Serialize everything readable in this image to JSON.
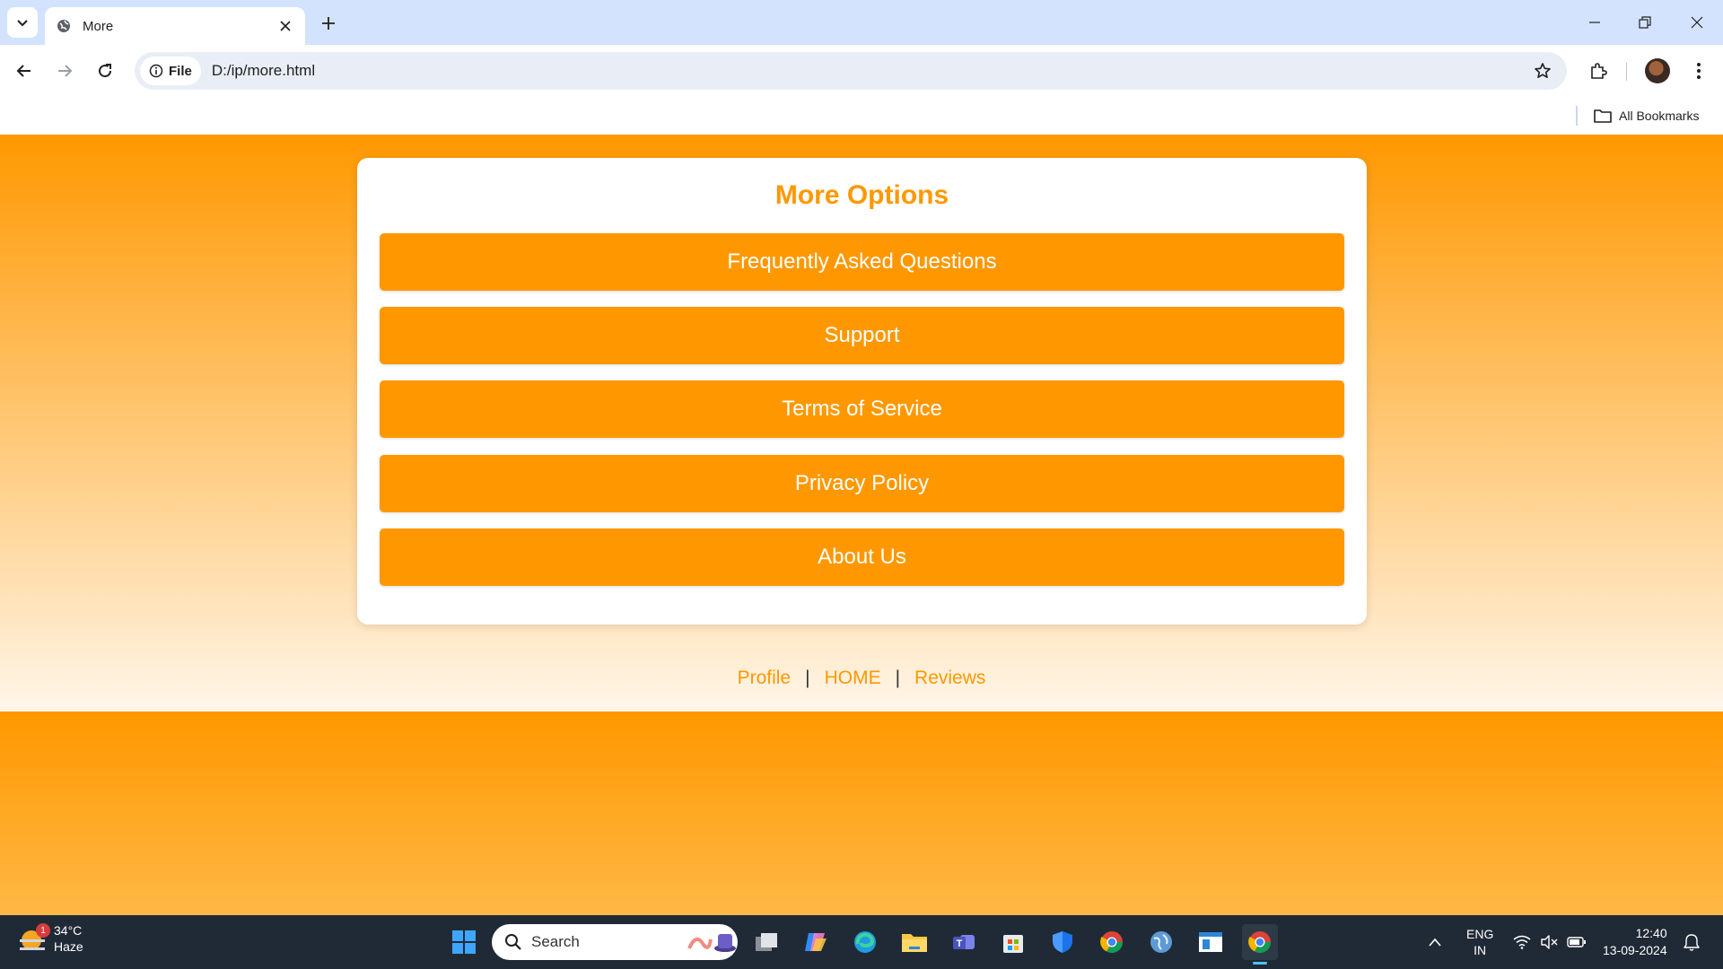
{
  "browser": {
    "tab_title": "More",
    "url_chip": "File",
    "url": "D:/ip/more.html",
    "bookmarks_label": "All Bookmarks"
  },
  "page": {
    "card_title": "More Options",
    "options": [
      "Frequently Asked Questions",
      "Support",
      "Terms of Service",
      "Privacy Policy",
      "About Us"
    ],
    "footer": {
      "profile": "Profile",
      "home": "HOME",
      "reviews": "Reviews",
      "separator": "|"
    },
    "accent_color": "#ff9800"
  },
  "taskbar": {
    "weather_temp": "34°C",
    "weather_desc": "Haze",
    "weather_badge": "1",
    "search_placeholder": "Search",
    "lang_top": "ENG",
    "lang_bottom": "IN",
    "time": "12:40",
    "date": "13-09-2024"
  }
}
